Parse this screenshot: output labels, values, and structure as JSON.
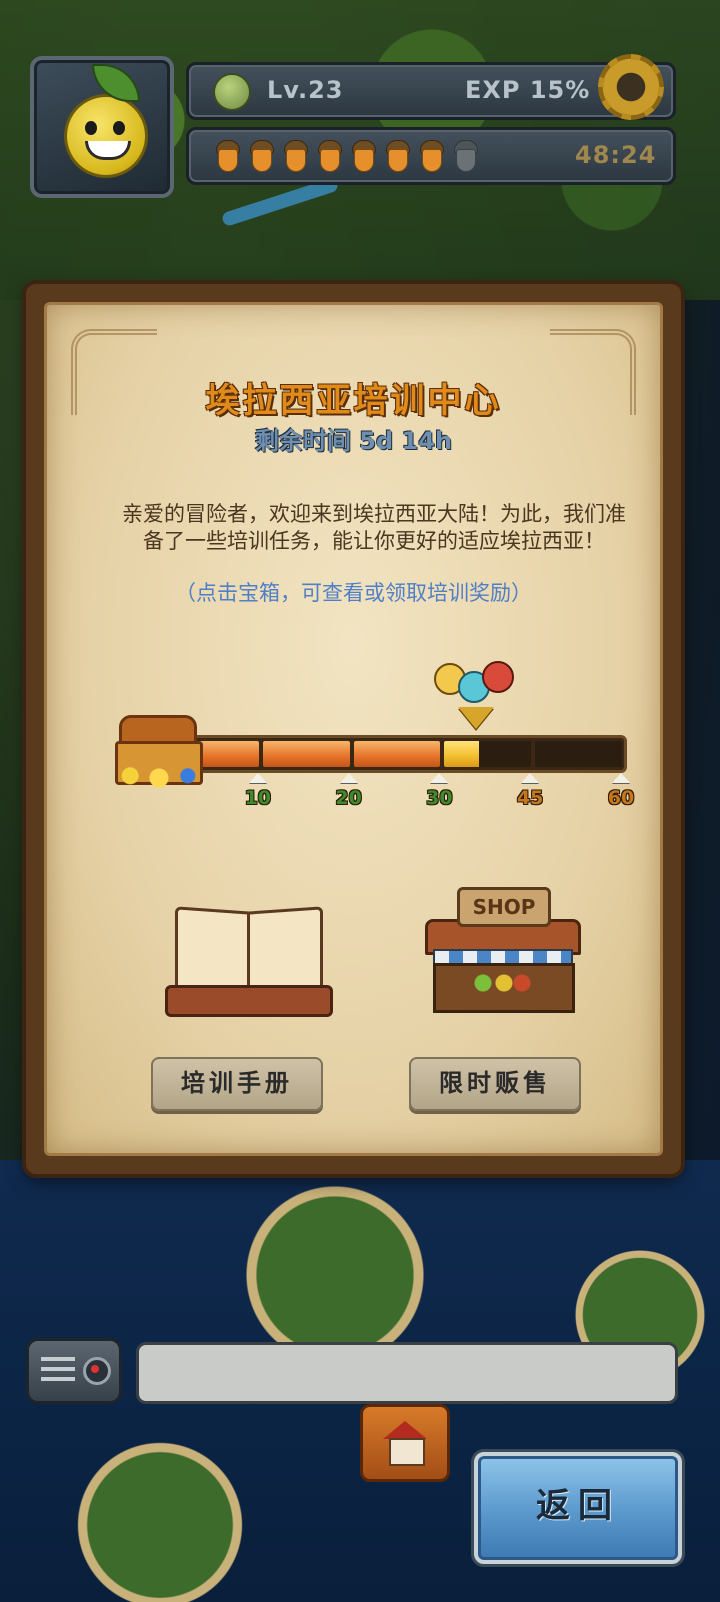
{
  "hud": {
    "level": "Lv.23",
    "exp": "EXP 15%",
    "stamina_filled": 7,
    "stamina_total": 8,
    "timer": "48:24"
  },
  "panel": {
    "title": "埃拉西亚培训中心",
    "remaining": "剩余时间 5d 14h",
    "description": "亲爱的冒险者，欢迎来到埃拉西亚大陆！为此，我们准备了一些培训任务，能让你更好的适应埃拉西亚！",
    "hint": "（点击宝箱，可查看或领取培训奖励）",
    "progress": {
      "current": 36,
      "max": 60,
      "milestones": [
        "10",
        "20",
        "30",
        "45",
        "60"
      ],
      "milestone_values": [
        10,
        20,
        30,
        45,
        60
      ]
    },
    "manual_label": "培训手册",
    "sale_label": "限时贩售",
    "shop_sign": "SHOP"
  },
  "bottom": {
    "back_label": "返回"
  },
  "colors": {
    "title": "#e08a1a",
    "hint": "#4f7fc6",
    "milestone_reached": "#3f8a2a",
    "milestone_next": "#c8761c"
  }
}
